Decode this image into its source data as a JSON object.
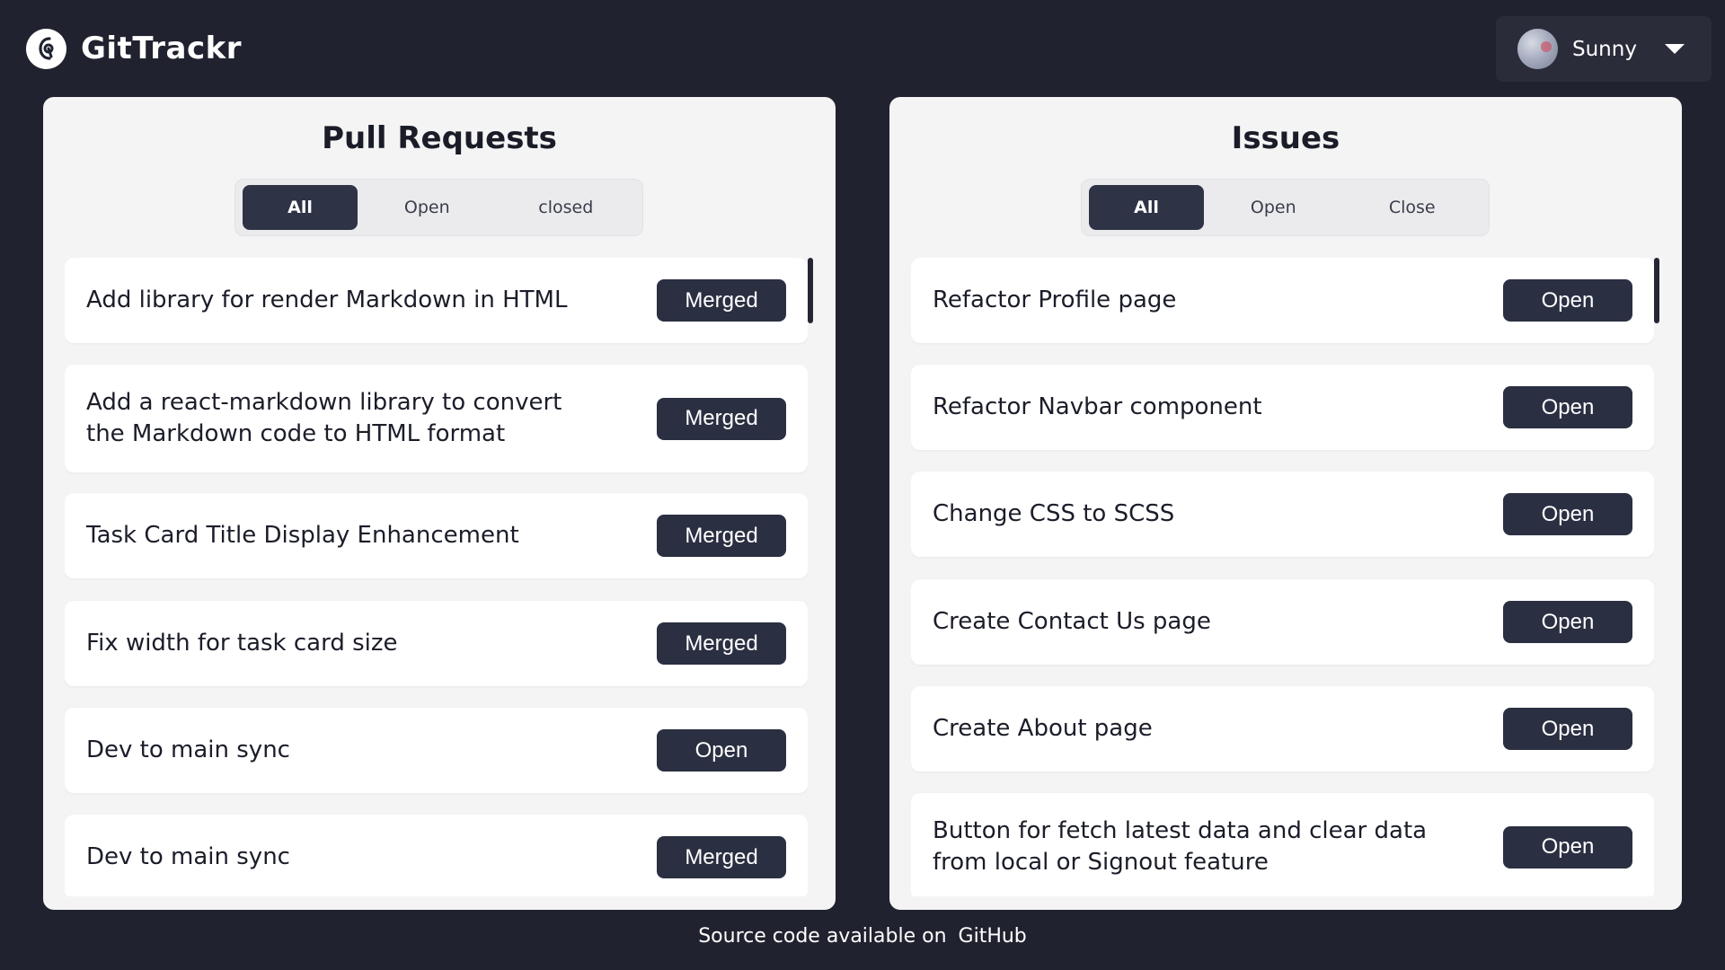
{
  "header": {
    "brand_name": "GitTrackr",
    "user_name": "Sunny"
  },
  "pull_requests": {
    "title": "Pull Requests",
    "tabs": [
      {
        "label": "All",
        "active": true
      },
      {
        "label": "Open",
        "active": false
      },
      {
        "label": "closed",
        "active": false
      }
    ],
    "items": [
      {
        "title": "Add library for render Markdown in HTML",
        "status": "Merged"
      },
      {
        "title": "Add a react-markdown library to convert the Markdown code to HTML format",
        "status": "Merged"
      },
      {
        "title": "Task Card Title Display Enhancement",
        "status": "Merged"
      },
      {
        "title": "Fix width for task card size",
        "status": "Merged"
      },
      {
        "title": "Dev to main sync",
        "status": "Open"
      },
      {
        "title": "Dev to main sync",
        "status": "Merged"
      }
    ]
  },
  "issues": {
    "title": "Issues",
    "tabs": [
      {
        "label": "All",
        "active": true
      },
      {
        "label": "Open",
        "active": false
      },
      {
        "label": "Close",
        "active": false
      }
    ],
    "items": [
      {
        "title": "Refactor Profile page",
        "status": "Open"
      },
      {
        "title": "Refactor Navbar component",
        "status": "Open"
      },
      {
        "title": "Change CSS to SCSS",
        "status": "Open"
      },
      {
        "title": "Create Contact Us page",
        "status": "Open"
      },
      {
        "title": "Create About page",
        "status": "Open"
      },
      {
        "title": "Button for fetch latest data and clear data from local or Signout feature",
        "status": "Open"
      }
    ]
  },
  "footer": {
    "text": "Source code available on",
    "link_label": "GitHub"
  },
  "colors": {
    "background": "#21222f",
    "panel": "#f4f4f5",
    "badge": "#2b2f42",
    "active_tab": "#2f3346"
  }
}
